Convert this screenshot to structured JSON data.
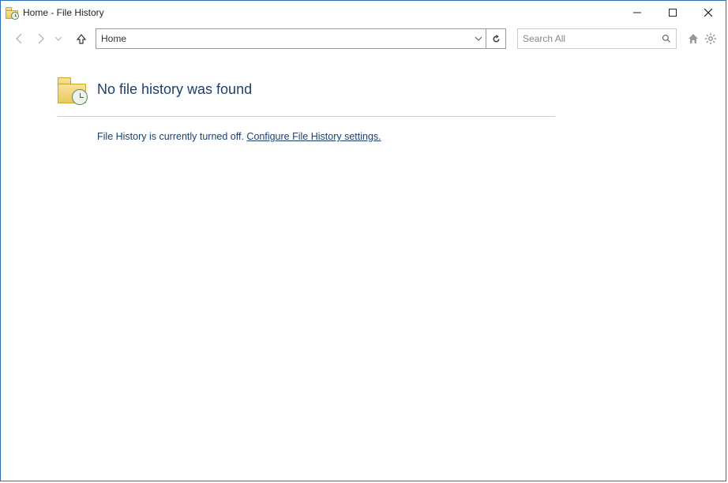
{
  "window": {
    "title": "Home - File History"
  },
  "nav": {
    "address": "Home",
    "search_placeholder": "Search All"
  },
  "main": {
    "heading": "No file history was found",
    "status": "File History is currently turned off. ",
    "link": "Configure File History settings."
  }
}
